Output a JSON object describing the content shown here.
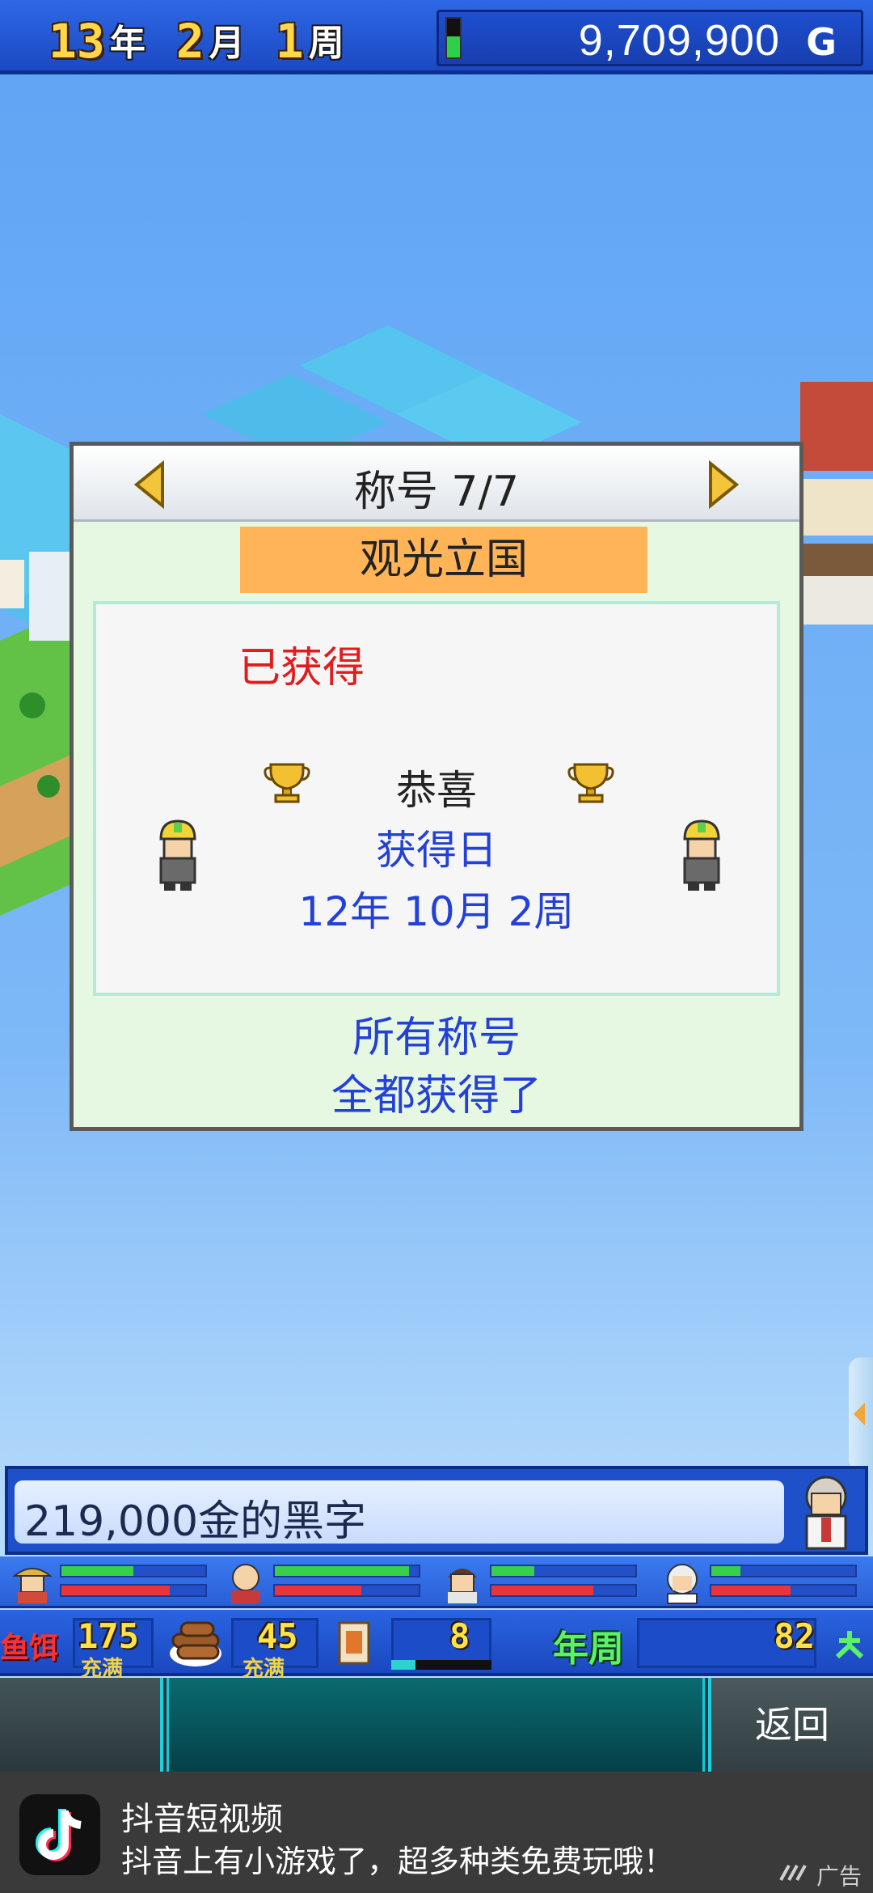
{
  "status": {
    "year": "13",
    "year_unit": "年",
    "month": "2",
    "month_unit": "月",
    "week": "1",
    "week_unit": "周",
    "money": "9,709,900",
    "money_unit": "G",
    "energy_level": 0.55
  },
  "dialog": {
    "title": "称号 7/7",
    "title_name": "观光立国",
    "obtained": "已获得",
    "congrats": "恭喜",
    "date_label": "获得日",
    "date_value": "12年 10月 2周",
    "all_titles_line1": "所有称号",
    "all_titles_line2": "全都获得了"
  },
  "message": {
    "text": "219,000金的黑字"
  },
  "staff": [
    {
      "stat1": 0.5,
      "stat2": 0.75
    },
    {
      "stat1": 0.93,
      "stat2": 0.6
    },
    {
      "stat1": 0.3,
      "stat2": 0.71
    },
    {
      "stat1": 0.2,
      "stat2": 0.55
    }
  ],
  "resources": {
    "label1": "鱼饵",
    "value1": "175",
    "sub1": "充满",
    "value2": "45",
    "sub2": "充满",
    "value3": "8",
    "label_week": "年周",
    "value_week": "82"
  },
  "nav": {
    "back_label": "返回"
  },
  "ad": {
    "title": "抖音短视频",
    "description": "抖音上有小游戏了，超多种类免费玩哦！",
    "tag": "广告"
  },
  "colors": {
    "sky": "#6aaaf5",
    "dialog_bg": "#e6f8e2",
    "banner": "#ffb457",
    "obtained": "#e21c1c",
    "info_text": "#2340d8"
  }
}
